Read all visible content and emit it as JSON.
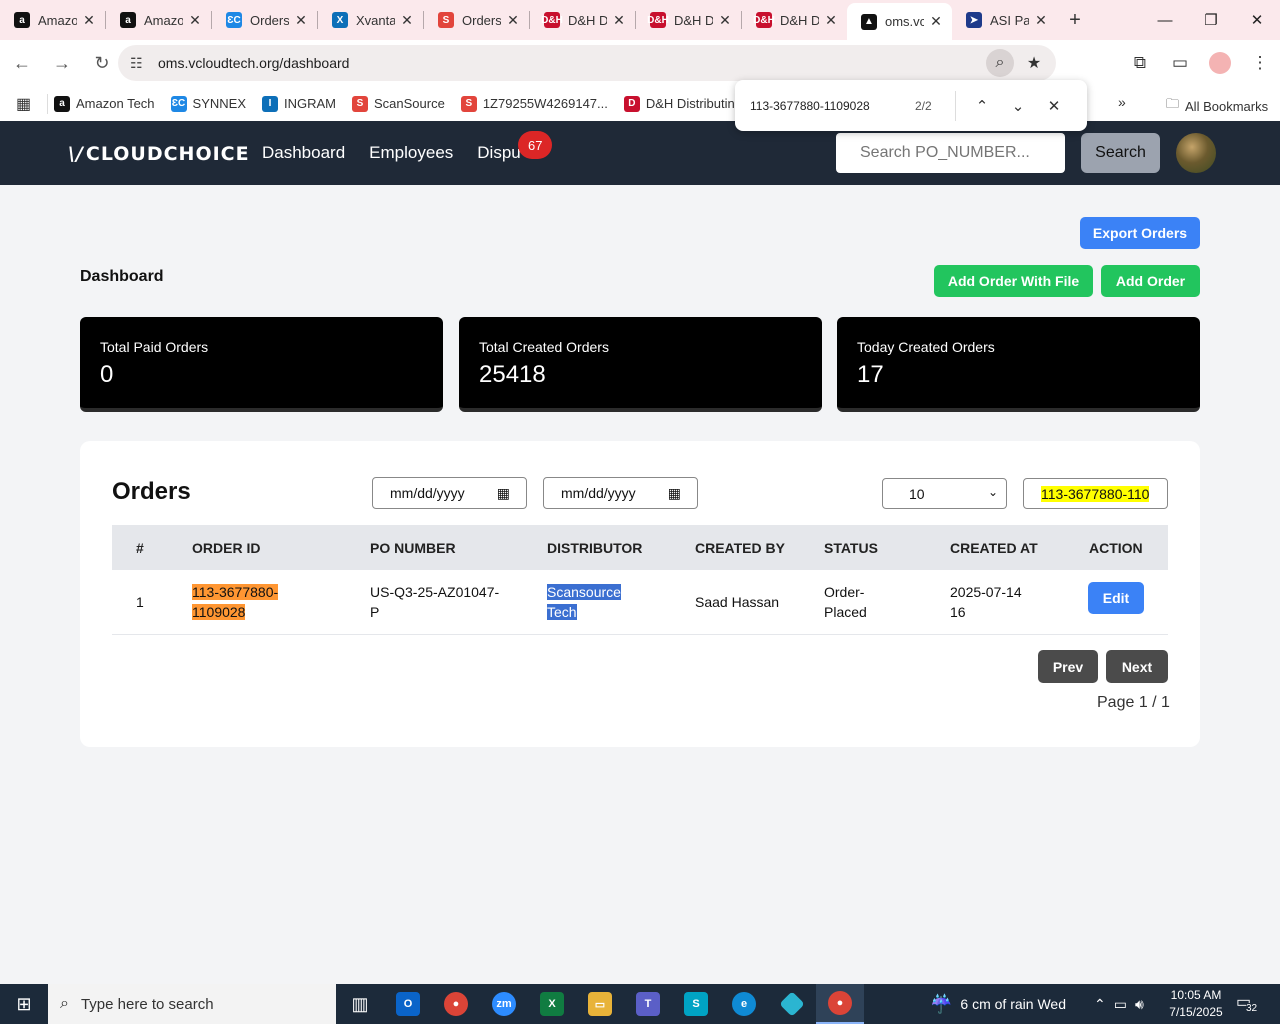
{
  "browser": {
    "tabs": [
      {
        "label": "Amazo",
        "icon": "amazon-icon",
        "color": "#111111",
        "glyph": "a"
      },
      {
        "label": "Amazo",
        "icon": "amazon-icon",
        "color": "#111111",
        "glyph": "a"
      },
      {
        "label": "Orders",
        "icon": "cloudchoice-icon",
        "color": "#1e88e5",
        "glyph": "ƐC"
      },
      {
        "label": "Xvanta",
        "icon": "xvantage-icon",
        "color": "#0d6fb8",
        "glyph": "X"
      },
      {
        "label": "Orders",
        "icon": "scansource-icon",
        "color": "#e2453c",
        "glyph": "S"
      },
      {
        "label": "D&H D",
        "icon": "dh-icon",
        "color": "#c8102e",
        "glyph": "D&H"
      },
      {
        "label": "D&H D",
        "icon": "dh-icon",
        "color": "#c8102e",
        "glyph": "D&H"
      },
      {
        "label": "D&H D",
        "icon": "dh-icon",
        "color": "#c8102e",
        "glyph": "D&H"
      },
      {
        "label": "oms.vc",
        "icon": "oms-icon",
        "color": "#111111",
        "glyph": "▲"
      },
      {
        "label": "ASI Pa",
        "icon": "asi-icon",
        "color": "#1e3a8a",
        "glyph": "➤"
      }
    ],
    "url": "oms.vcloudtech.org/dashboard",
    "bookmarks": [
      {
        "label": "Amazon Tech",
        "color": "#111111",
        "glyph": "a"
      },
      {
        "label": "SYNNEX",
        "color": "#1e88e5",
        "glyph": "ƐC"
      },
      {
        "label": "INGRAM",
        "color": "#0d6fb8",
        "glyph": "I"
      },
      {
        "label": "ScanSource",
        "color": "#e2453c",
        "glyph": "S"
      },
      {
        "label": "1Z79255W4269147...",
        "color": "#e2453c",
        "glyph": "S"
      },
      {
        "label": "D&H Distributing",
        "color": "#c8102e",
        "glyph": "D"
      }
    ],
    "all_bookmarks": "All Bookmarks",
    "find": {
      "query": "113-3677880-1109028",
      "count": "2/2"
    }
  },
  "header": {
    "logo": "CLOUDCHOICE",
    "nav": [
      "Dashboard",
      "Employees",
      "Dispu"
    ],
    "dispute_badge": "67",
    "search_placeholder": "Search PO_NUMBER...",
    "search_button": "Search"
  },
  "dashboard": {
    "title": "Dashboard",
    "export_button": "Export Orders",
    "add_file_button": "Add Order With File",
    "add_button": "Add Order",
    "stats": [
      {
        "label": "Total Paid Orders",
        "value": "0"
      },
      {
        "label": "Total Created Orders",
        "value": "25418"
      },
      {
        "label": "Today Created Orders",
        "value": "17"
      }
    ]
  },
  "orders": {
    "title": "Orders",
    "date_from": "mm/dd/yyyy",
    "date_to": "mm/dd/yyyy",
    "page_size": "10",
    "filter_value": "113-3677880-110",
    "columns": [
      "#",
      "ORDER ID",
      "PO NUMBER",
      "DISTRIBUTOR",
      "CREATED BY",
      "STATUS",
      "CREATED AT",
      "ACTION"
    ],
    "rows": [
      {
        "num": "1",
        "order_id_1": "113-3677880-",
        "order_id_2": "1109028",
        "po_1": "US-Q3-25-AZ01047-",
        "po_2": "P",
        "distributor_1": "Scansource",
        "distributor_2": "Tech",
        "created_by": "Saad Hassan",
        "status_1": "Order-",
        "status_2": "Placed",
        "created_at_1": "2025-07-14",
        "created_at_2": "16",
        "action": "Edit"
      }
    ],
    "prev": "Prev",
    "next": "Next",
    "page_info": "Page 1 / 1"
  },
  "taskbar": {
    "search_placeholder": "Type here to search",
    "weather": "6 cm of rain Wed",
    "time": "10:05 AM",
    "date": "7/15/2025",
    "notifications": "32"
  }
}
